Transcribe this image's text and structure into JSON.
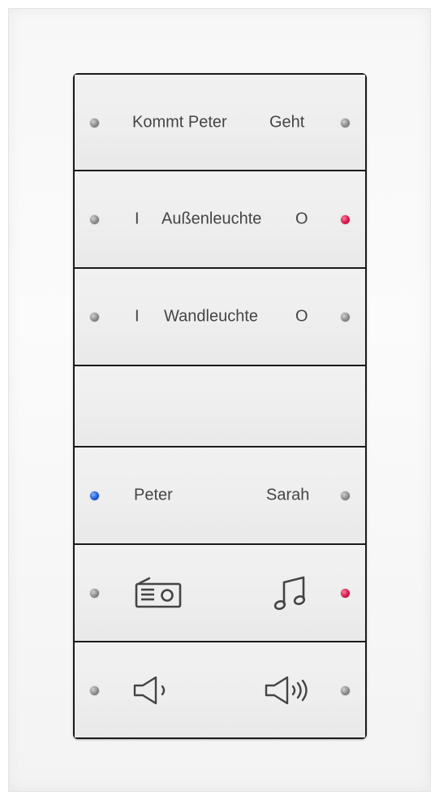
{
  "keys": [
    {
      "left_label": "Kommt Peter",
      "right_label": "Geht",
      "left_led": "grey",
      "right_led": "grey"
    },
    {
      "left_label": "I",
      "center_label": "Außenleuchte",
      "right_label": "O",
      "left_led": "grey",
      "right_led": "red"
    },
    {
      "left_label": "I",
      "center_label": "Wandleuchte",
      "right_label": "O",
      "left_led": "grey",
      "right_led": "grey"
    },
    {},
    {
      "left_label": "Peter",
      "right_label": "Sarah",
      "left_led": "blue",
      "right_led": "grey"
    },
    {
      "left_icon": "radio-icon",
      "right_icon": "music-note-icon",
      "left_led": "grey",
      "right_led": "red"
    },
    {
      "left_icon": "volume-down-icon",
      "right_icon": "volume-up-icon",
      "left_led": "grey",
      "right_led": "grey"
    }
  ],
  "colors": {
    "led_grey": "#8a8a8a",
    "led_red": "#d6164b",
    "led_blue": "#1f5bd6",
    "key_face": "#eeeeee",
    "panel_edge": "#1b1b1b"
  }
}
